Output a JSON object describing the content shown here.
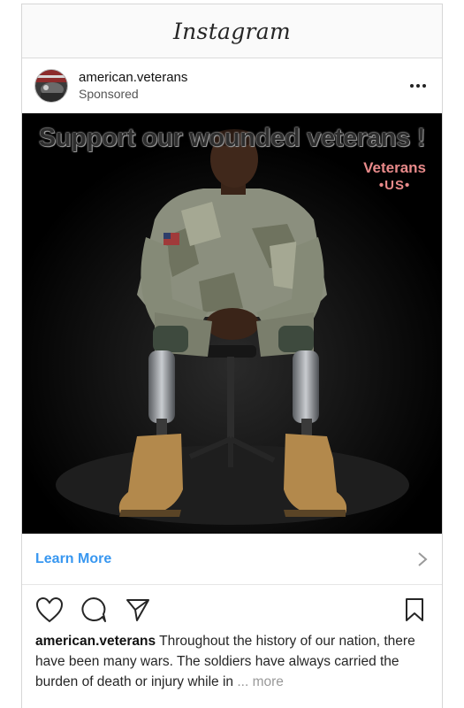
{
  "app": {
    "title": "Instagram"
  },
  "post": {
    "username": "american.veterans",
    "sponsored_label": "Sponsored",
    "image": {
      "headline": "Support our wounded veterans !",
      "watermark_line1": "Veterans",
      "watermark_line2": "•US•"
    },
    "cta_label": "Learn More",
    "caption_text": "Throughout the history of our nation, there have been many wars. The soldiers have always carried the burden of death or injury while in",
    "caption_ellipsis": " ... ",
    "caption_more": "more"
  },
  "icons": {
    "menu": "more-horizontal-icon",
    "cta": "chevron-right-icon",
    "like": "heart-icon",
    "comment": "comment-bubble-icon",
    "share": "paper-plane-icon",
    "save": "bookmark-icon"
  },
  "colors": {
    "cta": "#3897f0",
    "watermark": "#e88a8a",
    "image_background": "#000000"
  }
}
